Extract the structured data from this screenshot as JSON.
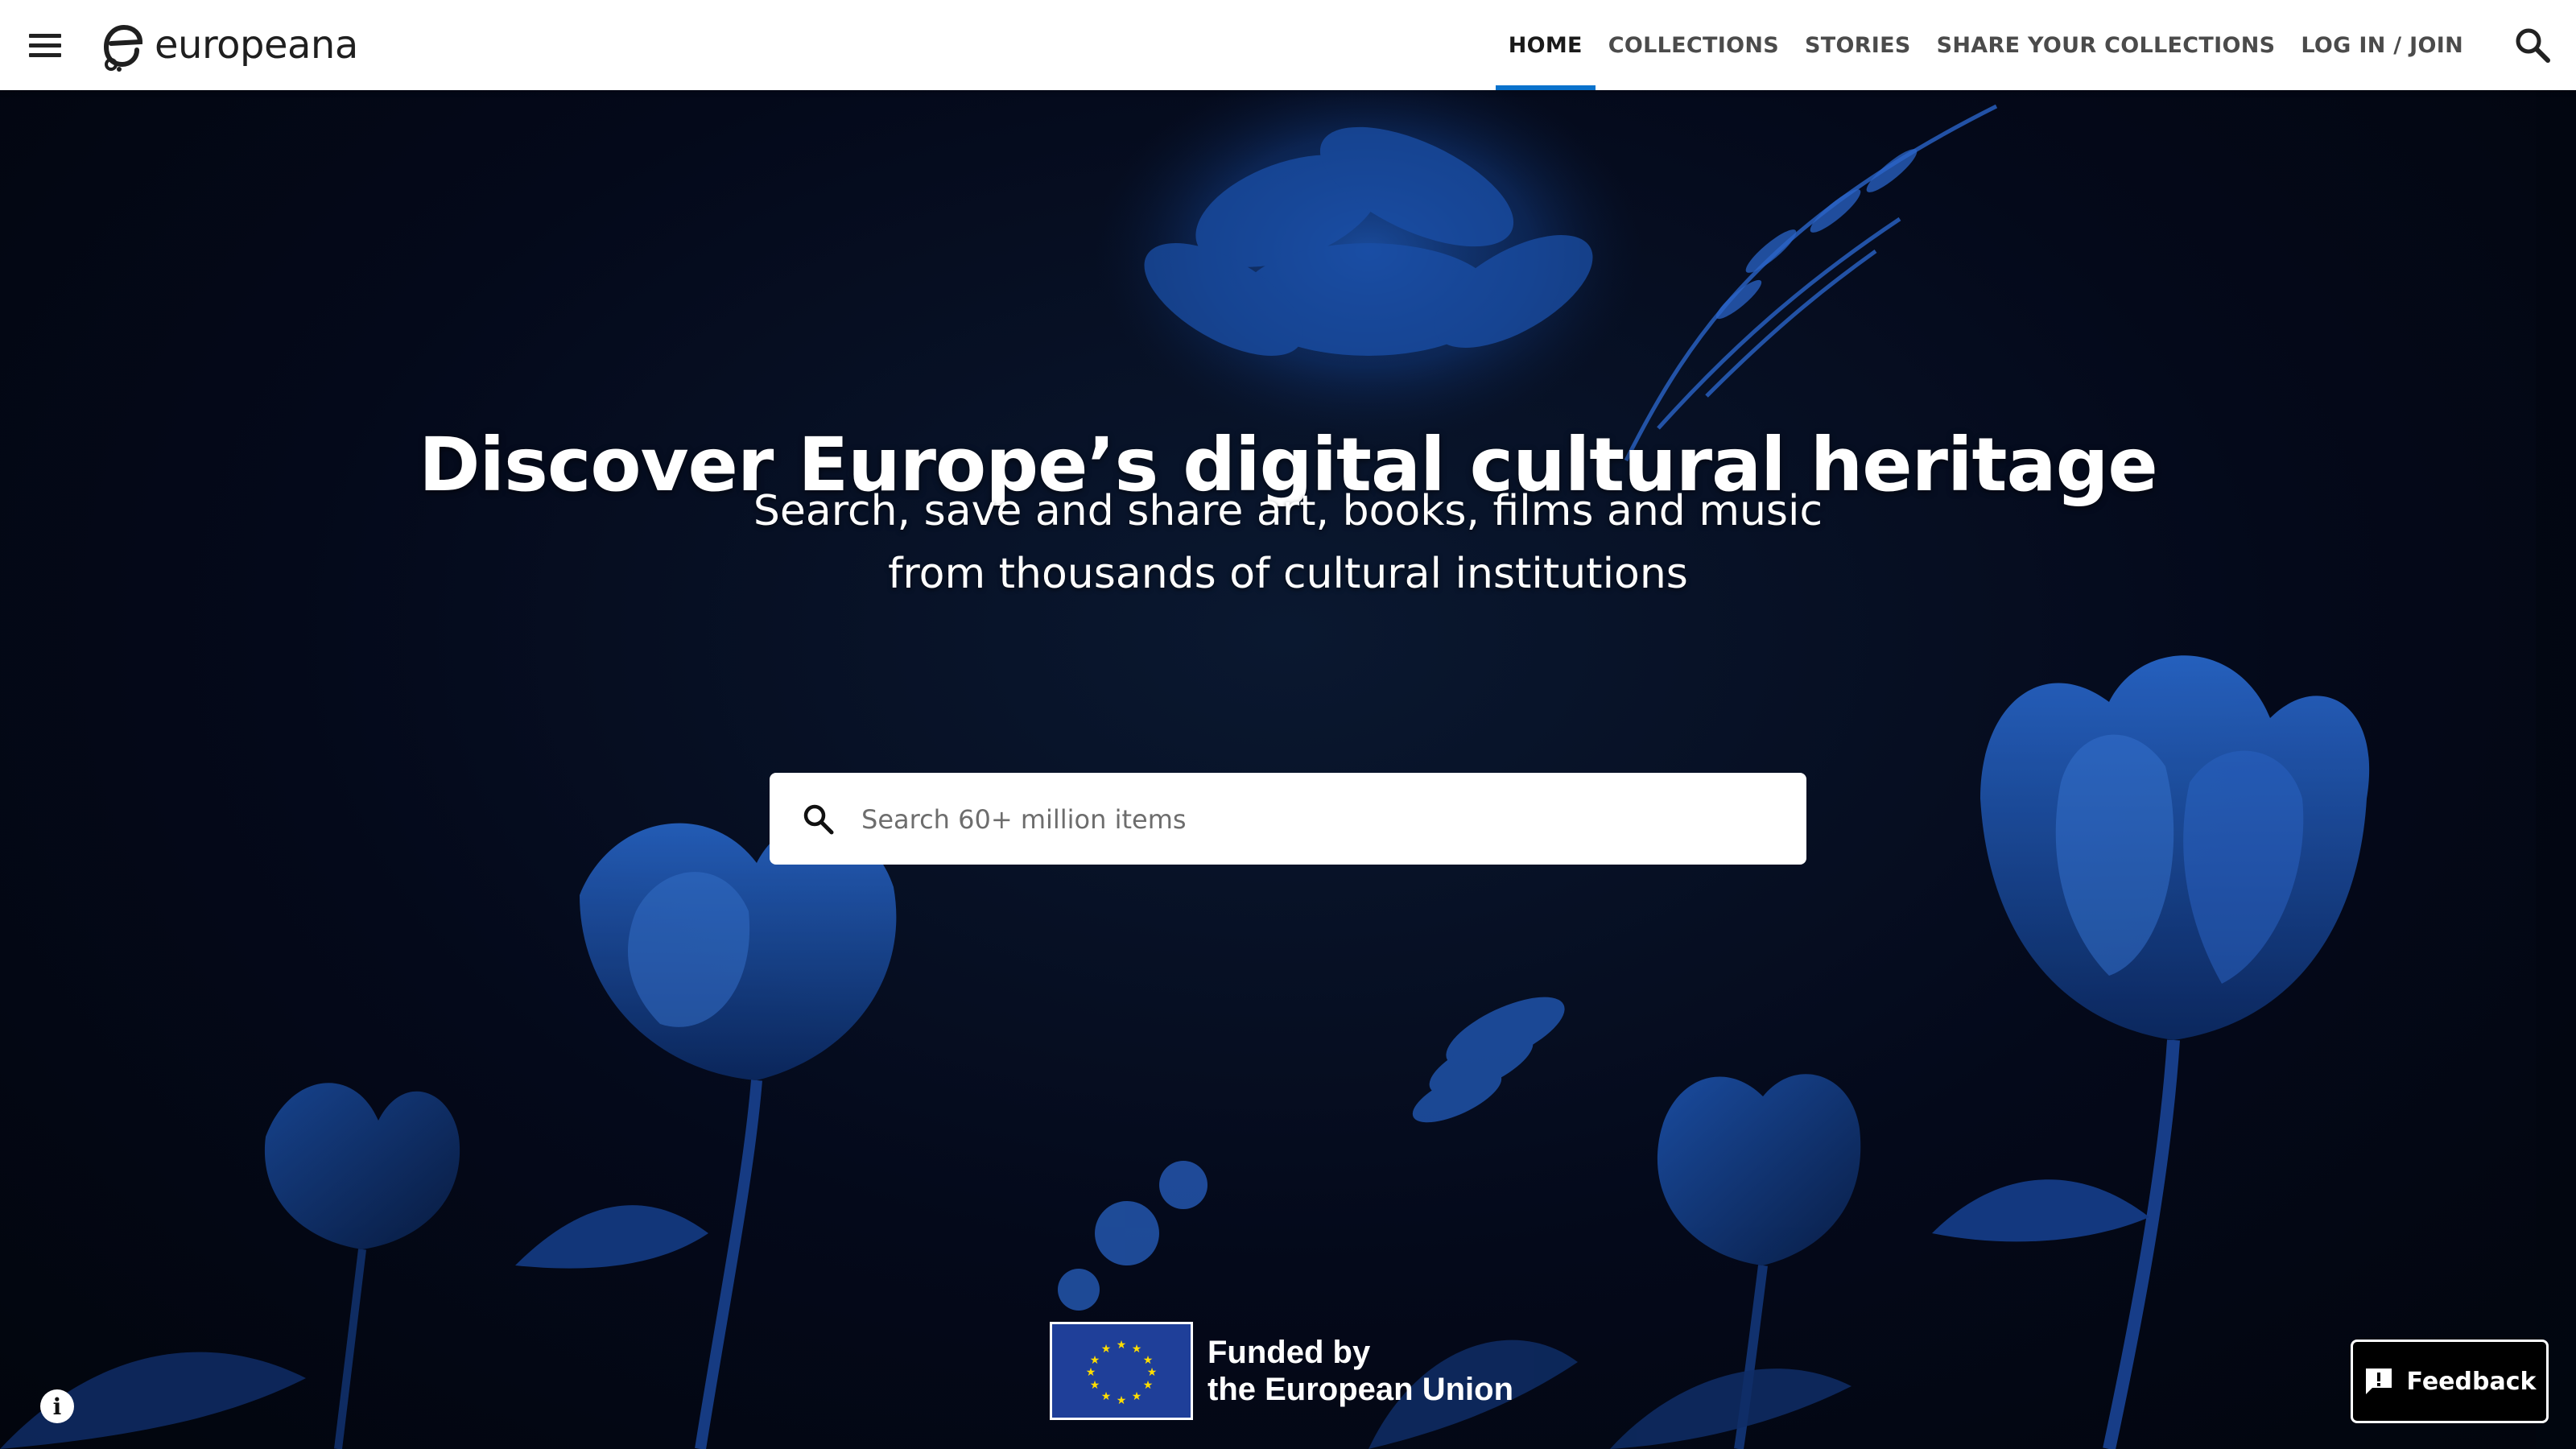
{
  "header": {
    "logo_text": "europeana",
    "menu_icon": "hamburger-menu-icon",
    "nav": [
      {
        "label": "HOME",
        "active": true
      },
      {
        "label": "COLLECTIONS",
        "active": false
      },
      {
        "label": "STORIES",
        "active": false
      },
      {
        "label": "SHARE YOUR COLLECTIONS",
        "active": false
      },
      {
        "label": "LOG IN / JOIN",
        "active": false
      }
    ],
    "search_icon": "search-icon"
  },
  "hero": {
    "title": "Discover Europe’s digital cultural heritage",
    "subtitle_line1": "Search, save and share art, books, films and music",
    "subtitle_line2": "from thousands of cultural institutions",
    "search_placeholder": "Search 60+ million items"
  },
  "footer": {
    "eu_line1": "Funded by",
    "eu_line2": "the European Union",
    "feedback_label": "Feedback",
    "info_icon": "info-icon"
  },
  "colors": {
    "accent": "#0a72cc",
    "hero_bg": "#030812",
    "flower_blue": "#1c56b4",
    "eu_blue": "#1f3f99",
    "eu_star": "#ffdd00"
  }
}
